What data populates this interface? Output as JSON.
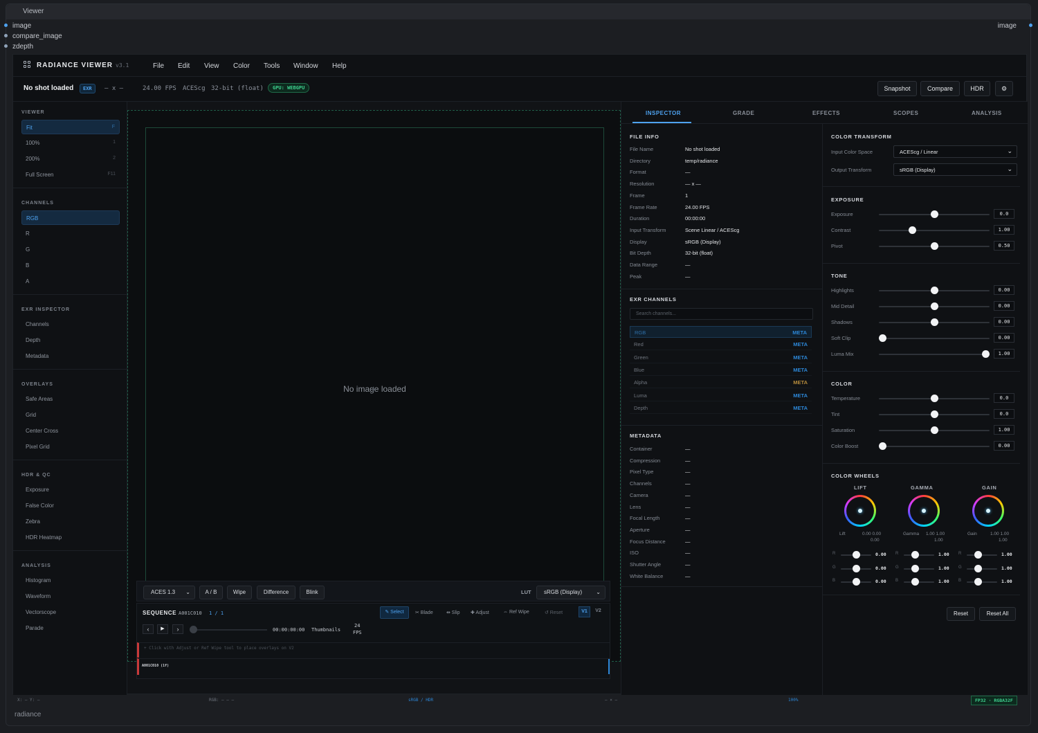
{
  "node": {
    "title": "Viewer",
    "inputs": [
      "image",
      "compare_image",
      "zdepth"
    ],
    "output": "image",
    "footer": "radiance"
  },
  "app": {
    "brand": "RADIANCE VIEWER",
    "version": "v3.1",
    "menu": [
      "File",
      "Edit",
      "View",
      "Color",
      "Tools",
      "Window",
      "Help"
    ]
  },
  "info": {
    "shot": "No shot loaded",
    "format": "EXR",
    "res": "— x —",
    "fps": "24.00 FPS",
    "cs": "ACEScg",
    "depth": "32-bit (float)",
    "gpu": "GPU: WEBGPU",
    "buttons": [
      "Snapshot",
      "Compare",
      "HDR"
    ]
  },
  "sidebar": {
    "viewer": {
      "title": "VIEWER",
      "items": [
        {
          "label": "Fit",
          "key": "F"
        },
        {
          "label": "100%",
          "key": "1"
        },
        {
          "label": "200%",
          "key": "2"
        },
        {
          "label": "Full Screen",
          "key": "F11"
        }
      ]
    },
    "channels": {
      "title": "CHANNELS",
      "items": [
        "RGB",
        "R",
        "G",
        "B",
        "A"
      ]
    },
    "exr": {
      "title": "EXR INSPECTOR",
      "items": [
        "Channels",
        "Depth",
        "Metadata"
      ]
    },
    "overlays": {
      "title": "OVERLAYS",
      "items": [
        "Safe Areas",
        "Grid",
        "Center Cross",
        "Pixel Grid"
      ]
    },
    "hdr": {
      "title": "HDR & QC",
      "items": [
        "Exposure",
        "False Color",
        "Zebra",
        "HDR Heatmap"
      ]
    },
    "analysis": {
      "title": "ANALYSIS",
      "items": [
        "Histogram",
        "Waveform",
        "Vectorscope",
        "Parade"
      ]
    }
  },
  "viewport": {
    "empty": "No image loaded"
  },
  "controls": {
    "aces": "ACES 1.3",
    "ab": "A / B",
    "wipe": "Wipe",
    "diff": "Difference",
    "blink": "Blink",
    "lut_label": "LUT",
    "lut": "sRGB (Display)"
  },
  "sequence": {
    "title": "SEQUENCE",
    "clip": "A001C010",
    "count": "1 / 1",
    "tools": [
      "✎ Select",
      "✂ Blade",
      "⇹ Slip",
      "✚ Adjust",
      "⇔ Ref Wipe",
      "↺ Reset"
    ],
    "tracks": [
      "V1",
      "V2"
    ],
    "timecode": "00:00:00:00",
    "thumbs": "Thumbnails",
    "fps": "24",
    "fps_unit": "FPS",
    "hint": "+ Click with Adjust or Ref Wipe tool to place overlays on V2",
    "clip_label": "A001C010 (1f)"
  },
  "status": {
    "xy": "X: — Y: —",
    "rgb": "RGB: — — —",
    "display": "sRGB / HDR",
    "dims": "— × —",
    "zoom": "100%",
    "fmt": "FP32 · RGBA32F"
  },
  "tabs": [
    "INSPECTOR",
    "GRADE",
    "EFFECTS",
    "SCOPES",
    "ANALYSIS"
  ],
  "fileinfo": {
    "title": "FILE INFO",
    "rows": [
      [
        "File Name",
        "No shot loaded"
      ],
      [
        "Directory",
        "temp/radiance"
      ],
      [
        "Format",
        "—"
      ],
      [
        "Resolution",
        "— x —"
      ],
      [
        "Frame",
        "1"
      ],
      [
        "Frame Rate",
        "24.00 FPS"
      ],
      [
        "Duration",
        "00:00:00"
      ],
      [
        "Input Transform",
        "Scene Linear / ACEScg"
      ],
      [
        "Display",
        "sRGB (Display)"
      ],
      [
        "Bit Depth",
        "32-bit (float)"
      ],
      [
        "Data Range",
        "—"
      ],
      [
        "Peak",
        "—"
      ]
    ]
  },
  "exrch": {
    "title": "EXR CHANNELS",
    "placeholder": "Search channels...",
    "rows": [
      [
        "RGB",
        "META"
      ],
      [
        "Red",
        "META"
      ],
      [
        "Green",
        "META"
      ],
      [
        "Blue",
        "META"
      ],
      [
        "Alpha",
        "META"
      ],
      [
        "Luma",
        "META"
      ],
      [
        "Depth",
        "META"
      ]
    ]
  },
  "metadata": {
    "title": "METADATA",
    "rows": [
      [
        "Container",
        "—"
      ],
      [
        "Compression",
        "—"
      ],
      [
        "Pixel Type",
        "—"
      ],
      [
        "Channels",
        "—"
      ],
      [
        "Camera",
        "—"
      ],
      [
        "Lens",
        "—"
      ],
      [
        "Focal Length",
        "—"
      ],
      [
        "Aperture",
        "—"
      ],
      [
        "Focus Distance",
        "—"
      ],
      [
        "ISO",
        "—"
      ],
      [
        "Shutter Angle",
        "—"
      ],
      [
        "White Balance",
        "—"
      ]
    ]
  },
  "ct": {
    "title": "COLOR TRANSFORM",
    "in_label": "Input Color Space",
    "in": "ACEScg / Linear",
    "out_label": "Output Transform",
    "out": "sRGB (Display)"
  },
  "exposure": {
    "title": "EXPOSURE",
    "rows": [
      {
        "label": "Exposure",
        "pos": 0.5,
        "val": "0.0"
      },
      {
        "label": "Contrast",
        "pos": 0.3,
        "val": "1.00"
      },
      {
        "label": "Pivot",
        "pos": 0.5,
        "val": "0.50"
      }
    ]
  },
  "tone": {
    "title": "TONE",
    "rows": [
      {
        "label": "Highlights",
        "pos": 0.5,
        "val": "0.00"
      },
      {
        "label": "Mid Detail",
        "pos": 0.5,
        "val": "0.00"
      },
      {
        "label": "Shadows",
        "pos": 0.5,
        "val": "0.00"
      },
      {
        "label": "Soft Clip",
        "pos": 0.03,
        "val": "0.00"
      },
      {
        "label": "Luma Mix",
        "pos": 0.96,
        "val": "1.00"
      }
    ]
  },
  "color": {
    "title": "COLOR",
    "rows": [
      {
        "label": "Temperature",
        "pos": 0.5,
        "val": "0.0"
      },
      {
        "label": "Tint",
        "pos": 0.5,
        "val": "0.0"
      },
      {
        "label": "Saturation",
        "pos": 0.5,
        "val": "1.00"
      },
      {
        "label": "Color Boost",
        "pos": 0.03,
        "val": "0.00"
      }
    ]
  },
  "wheels": {
    "title": "COLOR WHEELS",
    "items": [
      {
        "name": "LIFT",
        "label": "Lift",
        "v1": "0.00 0.00",
        "v2": "0.00",
        "rgb": [
          "0.00",
          "0.00",
          "0.00"
        ]
      },
      {
        "name": "GAMMA",
        "label": "Gamma",
        "v1": "1.00 1.00",
        "v2": "1.00",
        "rgb": [
          "1.00",
          "1.00",
          "1.00"
        ]
      },
      {
        "name": "GAIN",
        "label": "Gain",
        "v1": "1.00 1.00",
        "v2": "1.00",
        "rgb": [
          "1.00",
          "1.00",
          "1.00"
        ]
      }
    ],
    "ch": [
      "R",
      "G",
      "B"
    ]
  },
  "actions": {
    "reset": "Reset",
    "reset_all": "Reset All"
  },
  "colors": {
    "accent": "#4ea2ef",
    "gpu": "#3ecf8e",
    "alpha_meta": "#b48a3c"
  }
}
